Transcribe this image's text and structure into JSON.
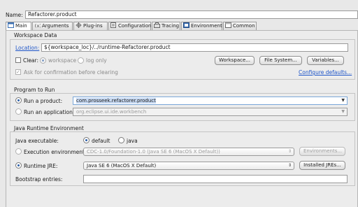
{
  "name_label": "Name:",
  "name_value": "Refactorer.product",
  "tabs": [
    {
      "label": "Main",
      "icon": "main-tab-icon"
    },
    {
      "label": "Arguments",
      "icon": "arguments-tab-icon"
    },
    {
      "label": "Plug-ins",
      "icon": "plugins-tab-icon"
    },
    {
      "label": "Configuration",
      "icon": "configuration-tab-icon"
    },
    {
      "label": "Tracing",
      "icon": "tracing-tab-icon"
    },
    {
      "label": "Environment",
      "icon": "environment-tab-icon"
    },
    {
      "label": "Common",
      "icon": "common-tab-icon"
    }
  ],
  "workspace": {
    "title": "Workspace Data",
    "location_label": "Location:",
    "location_value": "${workspace_loc}/../runtime-Refactorer.product",
    "clear_label": "Clear:",
    "clear_option_workspace": "workspace",
    "clear_option_log": "log only",
    "ask_confirm_label": "Ask for confirmation before clearing",
    "workspace_button": "Workspace...",
    "filesystem_button": "File System...",
    "variables_button": "Variables...",
    "configure_defaults_link": "Configure defaults..."
  },
  "program": {
    "title": "Program to Run",
    "run_product_label": "Run a product:",
    "product_value": "com.prosseek.refactorer.product",
    "run_application_label": "Run an application:",
    "application_value": "org.eclipse.ui.ide.workbench"
  },
  "jre": {
    "title": "Java Runtime Environment",
    "executable_label": "Java executable:",
    "executable_default": "default",
    "executable_java": "java",
    "exec_env_label": "Execution environment:",
    "exec_env_value": "CDC-1.0/Foundation-1.0 (Java SE 6 (MacOS X Default))",
    "environments_button": "Environments...",
    "runtime_jre_label": "Runtime JRE:",
    "runtime_jre_value": "Java SE 6 (MacOS X Default)",
    "installed_jres_button": "Installed JREs...",
    "bootstrap_label": "Bootstrap entries:",
    "bootstrap_value": ""
  },
  "colors": {
    "accent": "#2a5ea8",
    "link": "#1f56c9",
    "background": "#e8e8e8"
  }
}
